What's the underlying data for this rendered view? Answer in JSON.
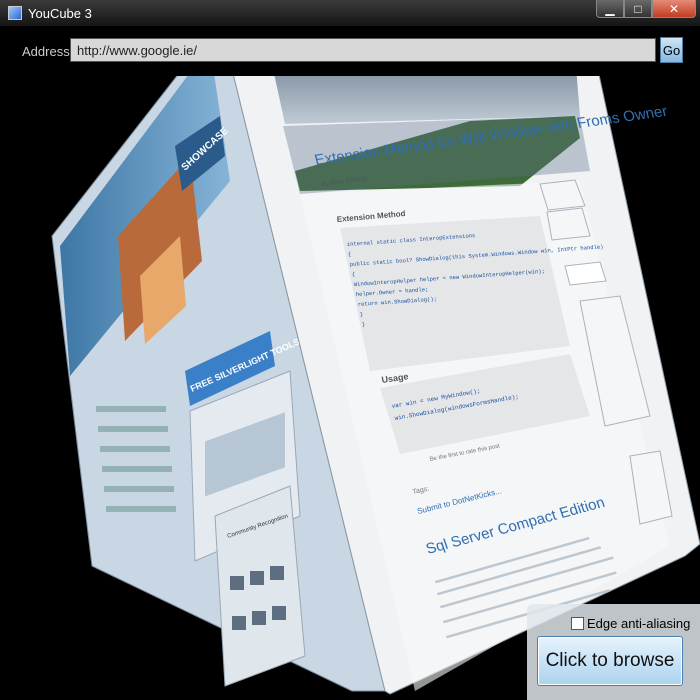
{
  "window": {
    "title": "YouCube 3",
    "controls": {
      "minimize": "▁",
      "maximize": "□",
      "close": "✕"
    }
  },
  "toolbar": {
    "address_label": "Address",
    "address_value": "http://www.google.ie/",
    "go_label": "Go"
  },
  "cube": {
    "right_face": {
      "heading": "Extension Method for Wpf Window with Froms Owner",
      "byline": "By Brian Keating",
      "section_title": "Extension Method",
      "code_lines": [
        "internal static class InteropExtensions",
        "{",
        "  public static bool? ShowDialog(this System.Windows.Window win, IntPtr handle)",
        "  {",
        "    WindowInteropHelper helper = new WindowInteropHelper(win);",
        "    helper.Owner = handle;",
        "    return win.ShowDialog();",
        "  }",
        "}"
      ],
      "usage_title": "Usage",
      "usage_lines": [
        "var win = new MyWindow();",
        "win.ShowDialog(windowsFormsHandle);"
      ],
      "rating_text": "Be the first to rate this post",
      "tags_label": "Tags:",
      "submit_link": "Submit to DotNetKicks...",
      "heading2": "Sql Server Compact Edition"
    },
    "left_face": {
      "showcase_label": "SHOWCASE",
      "silverlight_banner": "FREE SILVERLIGHT TOOLS",
      "community_label": "Community Recognition"
    }
  },
  "bottom": {
    "checkbox_label": "Edge anti-aliasing",
    "browse_label": "Click to browse"
  }
}
